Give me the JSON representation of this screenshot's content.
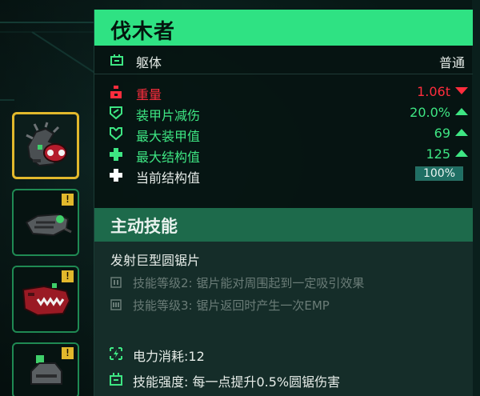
{
  "title": "伐木者",
  "class_row": {
    "label": "躯体",
    "value": "普通",
    "icon": "chassis-icon"
  },
  "stats": [
    {
      "icon": "weight-icon",
      "label": "重量",
      "value": "1.06t",
      "trend": "down",
      "color": "#ff2d3d"
    },
    {
      "icon": "shield-icon",
      "label": "装甲片减伤",
      "value": "20.0%",
      "trend": "up",
      "color": "#3ee683"
    },
    {
      "icon": "armor-icon",
      "label": "最大装甲值",
      "value": "69",
      "trend": "up",
      "color": "#3ee683"
    },
    {
      "icon": "plus-icon",
      "label": "最大结构值",
      "value": "125",
      "trend": "up",
      "color": "#3ee683"
    },
    {
      "icon": "plus-white-icon",
      "label": "当前结构值",
      "value": "100%",
      "bar_fraction": 1.0
    }
  ],
  "active_skill": {
    "header": "主动技能",
    "name": "发射巨型圆锯片",
    "levels": [
      {
        "icon": "level-2-icon",
        "text": "技能等级2: 锯片能对周围起到一定吸引效果"
      },
      {
        "icon": "level-3-icon",
        "text": "技能等级3: 锯片返回时产生一次EMP"
      }
    ],
    "power": {
      "icon": "power-icon",
      "text": "电力消耗:12"
    },
    "strength": {
      "icon": "chassis-icon",
      "text": "技能强度: 每一点提升0.5%圆锯伤害"
    }
  },
  "slots": [
    {
      "name": "slot-lumberjack",
      "selected": true,
      "warning": ""
    },
    {
      "name": "slot-drone",
      "selected": false,
      "warning": "!"
    },
    {
      "name": "slot-shark-jaw",
      "selected": false,
      "warning": "!"
    },
    {
      "name": "slot-turret",
      "selected": false,
      "warning": "!"
    }
  ],
  "colors": {
    "accent": "#2fe283",
    "negative": "#ff2d3d",
    "positive": "#3ee683",
    "slot_selected": "#e2b82c",
    "slot_border": "#1f8a53"
  }
}
